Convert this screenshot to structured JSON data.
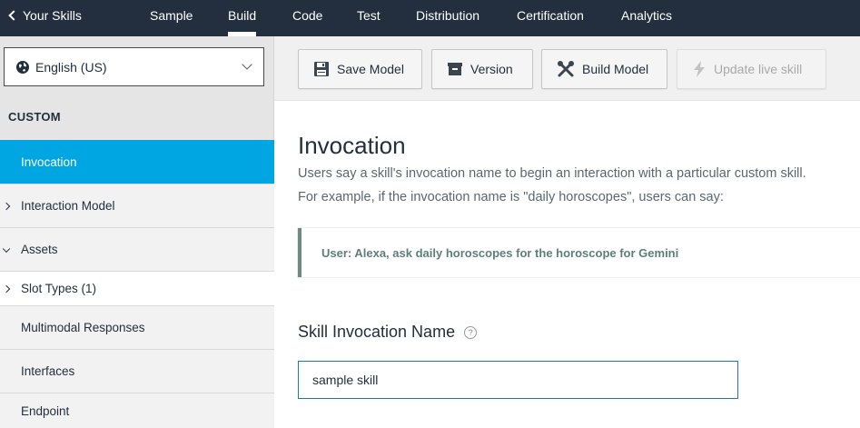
{
  "nav": {
    "back_label": "Your Skills",
    "tabs": [
      {
        "label": "Sample"
      },
      {
        "label": "Build"
      },
      {
        "label": "Code"
      },
      {
        "label": "Test"
      },
      {
        "label": "Distribution"
      },
      {
        "label": "Certification"
      },
      {
        "label": "Analytics"
      }
    ],
    "active_tab": "Build"
  },
  "sidebar": {
    "locale": "English (US)",
    "section_label": "CUSTOM",
    "items": [
      {
        "label": "Invocation",
        "state": "active",
        "caret": "none"
      },
      {
        "label": "Interaction Model",
        "caret": "collapsed"
      },
      {
        "label": "Assets",
        "caret": "expanded"
      },
      {
        "label": "Slot Types (1)",
        "caret": "collapsed"
      },
      {
        "label": "Multimodal Responses",
        "caret": "none"
      },
      {
        "label": "Interfaces",
        "caret": "none"
      },
      {
        "label": "Endpoint",
        "caret": "none"
      }
    ]
  },
  "toolbar": {
    "save_label": "Save Model",
    "version_label": "Version",
    "build_label": "Build Model",
    "update_label": "Update live skill",
    "update_enabled": false
  },
  "main": {
    "title": "Invocation",
    "description_line1": "Users say a skill's invocation name to begin an interaction with a particular custom skill.",
    "description_line2": "For example, if the invocation name is \"daily horoscopes\", users can say:",
    "example": "User: Alexa, ask daily horoscopes for the horoscope for Gemini",
    "field_label": "Skill Invocation Name",
    "field_value": "sample skill"
  },
  "colors": {
    "nav_bg": "#232f3e",
    "active_item": "#00a6e2",
    "example_accent": "#6b8c82",
    "input_border": "#1a7f9a"
  }
}
